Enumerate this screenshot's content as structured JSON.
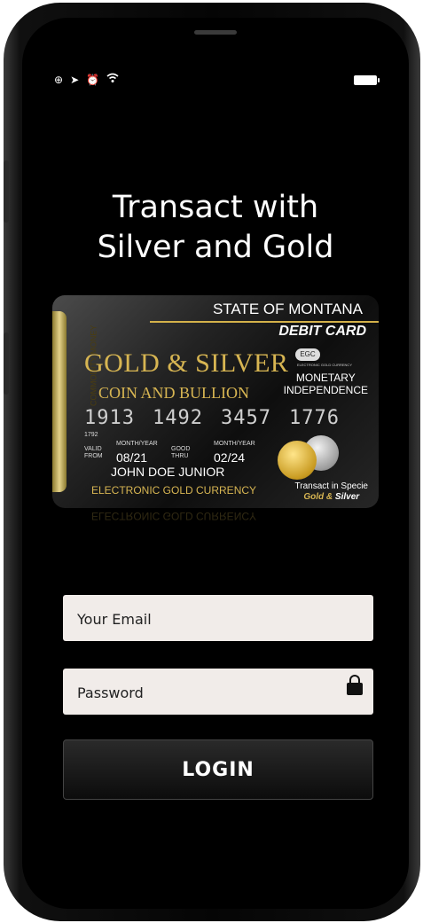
{
  "headline": {
    "line1": "Transact with",
    "line2": "Silver and Gold"
  },
  "status_bar": {
    "icons": [
      "vpn-icon",
      "location-icon",
      "alarm-icon",
      "wifi-icon"
    ],
    "battery": "battery-icon"
  },
  "card": {
    "state": "STATE OF MONTANA",
    "type": "DEBIT CARD",
    "side_text": "COMMODITY MONEY",
    "brand": "GOLD & SILVER",
    "brand_sub": "COIN AND BULLION",
    "badge": "EGC",
    "badge_caption": "ELECTRONIC GOLD CURRENCY",
    "monetary_line1": "MONETARY",
    "monetary_line2": "INDEPENDENCE",
    "number": [
      "1913",
      "1492",
      "3457",
      "1776"
    ],
    "number_small": "1792",
    "valid_from_label1": "VALID",
    "valid_from_label2": "FROM",
    "month_year_label": "MONTH/YEAR",
    "valid_from": "08/21",
    "good_thru_label1": "GOOD",
    "good_thru_label2": "THRU",
    "good_thru": "02/24",
    "holder": "JOHN DOE JUNIOR",
    "currency_line": "ELECTRONIC GOLD CURRENCY",
    "specie": "Transact in Specie",
    "specie_gold": "Gold",
    "specie_amp": " & ",
    "specie_silver": "Silver"
  },
  "form": {
    "email_placeholder": "Your Email",
    "password_placeholder": "Password",
    "login_label": "LOGIN"
  },
  "colors": {
    "gold": "#d7b552",
    "field_bg": "#f1ece9",
    "screen_bg": "#000000"
  }
}
